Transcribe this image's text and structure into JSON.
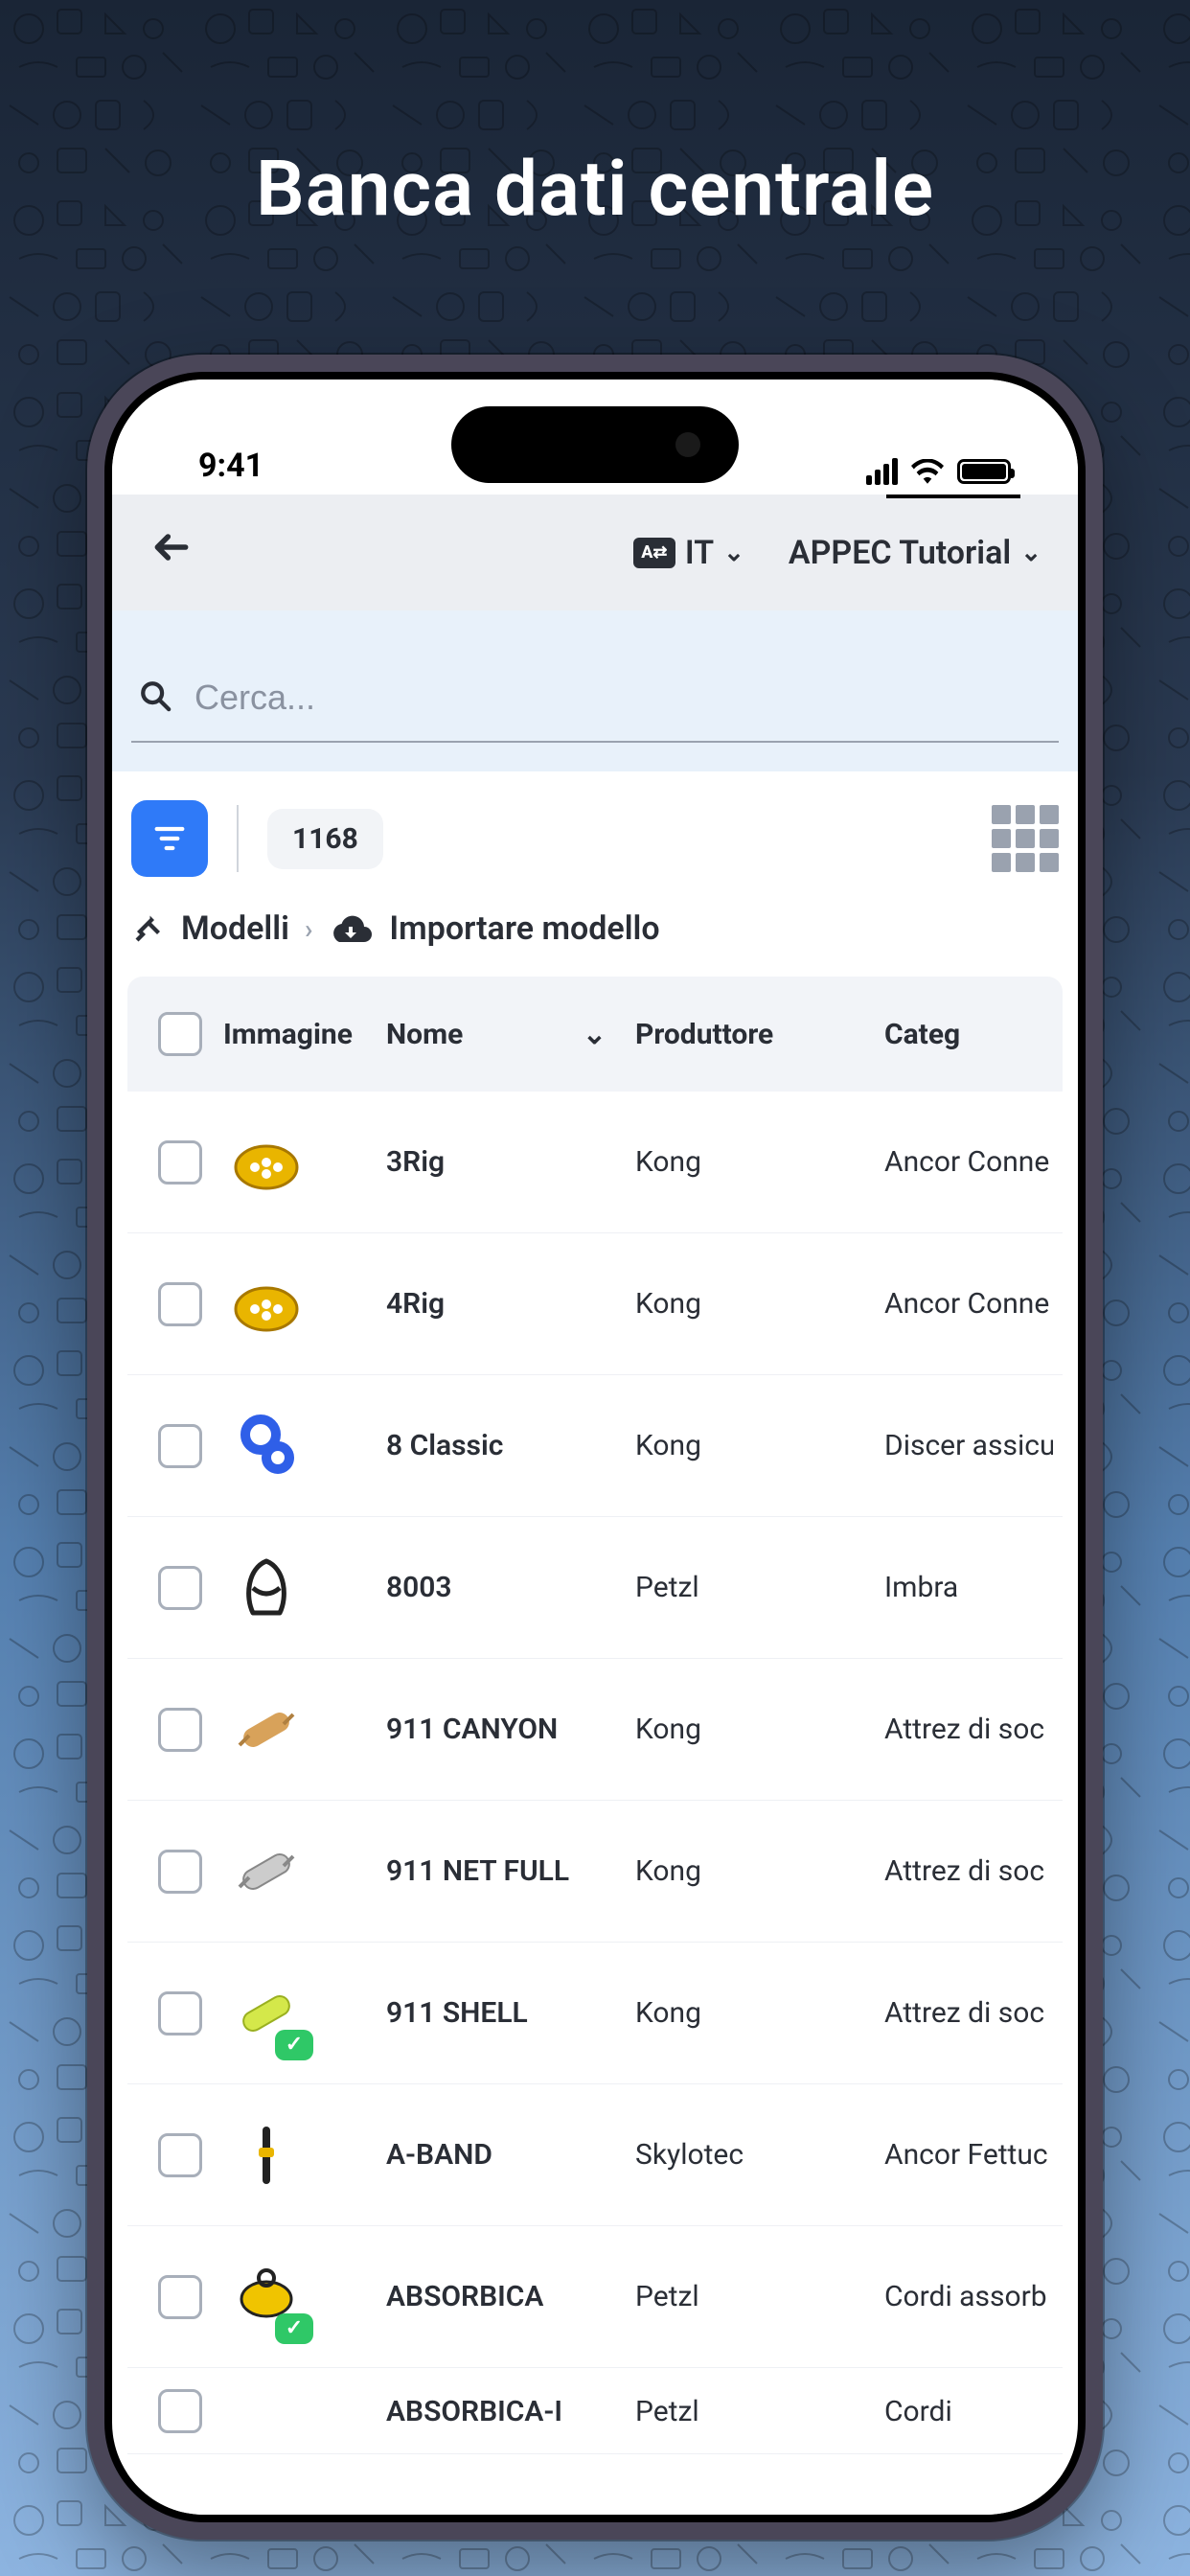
{
  "marketing_title": "Banca dati centrale",
  "status": {
    "time": "9:41"
  },
  "header": {
    "language_code": "IT",
    "tenant": "APPEC Tutorial"
  },
  "search": {
    "placeholder": "Cerca..."
  },
  "filter": {
    "count": "1168"
  },
  "breadcrumb": {
    "root": "Modelli",
    "current": "Importare modello"
  },
  "table": {
    "columns": {
      "image": "Immagine",
      "name": "Nome",
      "manufacturer": "Produttore",
      "category": "Categ"
    },
    "rows": [
      {
        "name": "3Rig",
        "manufacturer": "Kong",
        "category": "Ancor Conne",
        "thumb": "plate-yellow",
        "verified": false
      },
      {
        "name": "4Rig",
        "manufacturer": "Kong",
        "category": "Ancor Conne",
        "thumb": "plate-yellow",
        "verified": false
      },
      {
        "name": "8 Classic",
        "manufacturer": "Kong",
        "category": "Discer assicu",
        "thumb": "figure8-blue",
        "verified": false
      },
      {
        "name": "8003",
        "manufacturer": "Petzl",
        "category": "Imbra",
        "thumb": "harness-dark",
        "verified": false
      },
      {
        "name": "911 CANYON",
        "manufacturer": "Kong",
        "category": "Attrez di soc",
        "thumb": "stretcher-tan",
        "verified": false
      },
      {
        "name": "911 NET FULL",
        "manufacturer": "Kong",
        "category": "Attrez di soc",
        "thumb": "stretcher-grey",
        "verified": false
      },
      {
        "name": "911 SHELL",
        "manufacturer": "Kong",
        "category": "Attrez di soc",
        "thumb": "stretcher-lime",
        "verified": true
      },
      {
        "name": "A-BAND",
        "manufacturer": "Skylotec",
        "category": "Ancor Fettuc",
        "thumb": "band-dark",
        "verified": false
      },
      {
        "name": "ABSORBICA",
        "manufacturer": "Petzl",
        "category": "Cordi assorb",
        "thumb": "absorber-yellow",
        "verified": true
      },
      {
        "name": "ABSORBICA-I",
        "manufacturer": "Petzl",
        "category": "Cordi",
        "thumb": "",
        "verified": false
      }
    ]
  }
}
